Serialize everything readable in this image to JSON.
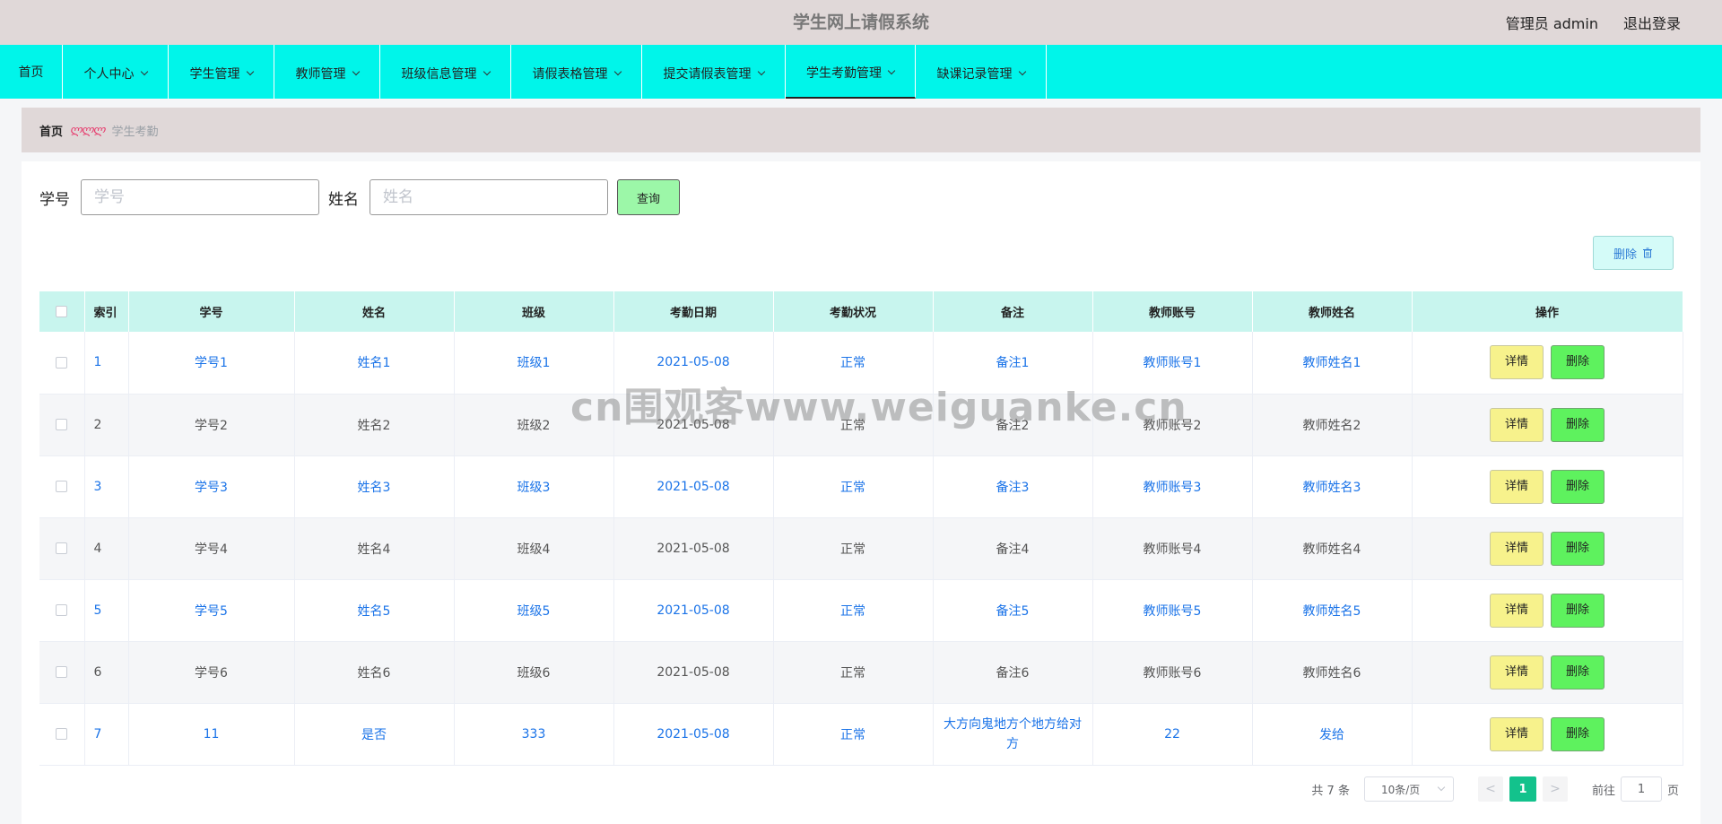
{
  "header": {
    "title": "学生网上请假系统",
    "user_label": "管理员 admin",
    "logout": "退出登录"
  },
  "nav": {
    "items": [
      {
        "label": "首页"
      },
      {
        "label": "个人中心"
      },
      {
        "label": "学生管理"
      },
      {
        "label": "教师管理"
      },
      {
        "label": "班级信息管理"
      },
      {
        "label": "请假表格管理"
      },
      {
        "label": "提交请假表管理"
      },
      {
        "label": "学生考勤管理"
      },
      {
        "label": "缺课记录管理"
      }
    ],
    "active": "学生考勤管理"
  },
  "breadcrumb": {
    "home": "首页",
    "separator": "ლლლ",
    "current": "学生考勤"
  },
  "search": {
    "student_no_label": "学号",
    "student_no_placeholder": "学号",
    "name_label": "姓名",
    "name_placeholder": "姓名",
    "query_button": "查询"
  },
  "toolbar": {
    "delete_label": "删除"
  },
  "table": {
    "columns": [
      "索引",
      "学号",
      "姓名",
      "班级",
      "考勤日期",
      "考勤状况",
      "备注",
      "教师账号",
      "教师姓名",
      "操作"
    ],
    "rows": [
      {
        "index": "1",
        "student_no": "学号1",
        "name": "姓名1",
        "class": "班级1",
        "date": "2021-05-08",
        "status": "正常",
        "remark": "备注1",
        "teacher_account": "教师账号1",
        "teacher_name": "教师姓名1"
      },
      {
        "index": "2",
        "student_no": "学号2",
        "name": "姓名2",
        "class": "班级2",
        "date": "2021-05-08",
        "status": "正常",
        "remark": "备注2",
        "teacher_account": "教师账号2",
        "teacher_name": "教师姓名2"
      },
      {
        "index": "3",
        "student_no": "学号3",
        "name": "姓名3",
        "class": "班级3",
        "date": "2021-05-08",
        "status": "正常",
        "remark": "备注3",
        "teacher_account": "教师账号3",
        "teacher_name": "教师姓名3"
      },
      {
        "index": "4",
        "student_no": "学号4",
        "name": "姓名4",
        "class": "班级4",
        "date": "2021-05-08",
        "status": "正常",
        "remark": "备注4",
        "teacher_account": "教师账号4",
        "teacher_name": "教师姓名4"
      },
      {
        "index": "5",
        "student_no": "学号5",
        "name": "姓名5",
        "class": "班级5",
        "date": "2021-05-08",
        "status": "正常",
        "remark": "备注5",
        "teacher_account": "教师账号5",
        "teacher_name": "教师姓名5"
      },
      {
        "index": "6",
        "student_no": "学号6",
        "name": "姓名6",
        "class": "班级6",
        "date": "2021-05-08",
        "status": "正常",
        "remark": "备注6",
        "teacher_account": "教师账号6",
        "teacher_name": "教师姓名6"
      },
      {
        "index": "7",
        "student_no": "11",
        "name": "是否",
        "class": "333",
        "date": "2021-05-08",
        "status": "正常",
        "remark": "大方向鬼地方个地方给对方",
        "teacher_account": "22",
        "teacher_name": "发给"
      }
    ],
    "detail_label": "详情",
    "delete_label": "删除"
  },
  "pagination": {
    "total": "共 7 条",
    "page_size": "10条/页",
    "prev": "<",
    "current_page": "1",
    "next": ">",
    "goto_prefix": "前往",
    "goto_value": "1",
    "goto_suffix": "页"
  },
  "watermark": "cn围观客www.weiguanke.cn",
  "colors": {
    "header_bg": "#e0d8d8",
    "nav_bg": "#00f5ea",
    "table_header_bg": "#c8f5ee",
    "link_blue": "#1a73e8",
    "detail_btn": "#f7f28c",
    "delete_btn": "#5ef25e",
    "page_active": "#13c28c"
  }
}
